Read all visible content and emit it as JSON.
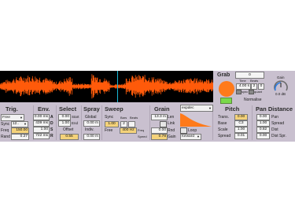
{
  "colors": {
    "accent": "#ff7a1a",
    "panel": "#c9c0cf",
    "waveform": "#ff5a0a",
    "playhead": "#19b8d6",
    "highlight": "#f4d27a",
    "normalise": "#7ad94a"
  },
  "sections": {
    "trig": "Trig.",
    "env": "Env.",
    "select": "Select",
    "spray": "Spray",
    "sweep": "Sweep",
    "grain": "Grain",
    "pitch": "Pitch",
    "pan_distance": "Pan Distance"
  },
  "trig": {
    "mode": "Free",
    "sync_label": "Sync",
    "sync_value": "12..",
    "freq_label": "Freq",
    "freq_value": "150.00",
    "rand_label": "Rand",
    "rand_value": "0.27"
  },
  "env": {
    "a_value": "0.00 ms",
    "a_label": "A",
    "d_value": "439 ms",
    "d_label": "D",
    "s_value": "1.00",
    "s_label": "S",
    "r_value": "722 ms",
    "r_label": "R"
  },
  "select": {
    "start_value": "0.00",
    "start_label": "Start",
    "end_value": "1.00",
    "end_label": "End",
    "offset_label": "Offset",
    "offset_value": "0.55"
  },
  "spray": {
    "global_label": "Global",
    "global_value": "0.00 m",
    "indiv_label": "Indiv.",
    "indiv_value": "0.00 m"
  },
  "sweep": {
    "sync_label": "Sync",
    "sync_value": "1.00",
    "bars_label": "Bars",
    "beats_label": "Beats",
    "beats_value": "2",
    "free_label": "Free",
    "free_value": "400 Hz",
    "freq_label": "Freq",
    "speed_label": "Speed"
  },
  "grain": {
    "len_value": "13.3 m",
    "len_label": "Len",
    "link_label": "Link",
    "rnd_value": "0.00",
    "rnd_label": "Rnd",
    "gain_value": "0.78",
    "gain_label": "Gain"
  },
  "window": {
    "shape": "expdec",
    "loop_label": "Loop",
    "direction": "forward"
  },
  "grab": {
    "title": "Grab",
    "field": "0",
    "time_label": "Time",
    "beats_label": "Beats",
    "time_value": "4.00 s",
    "beats_value": "2",
    "beats_b": "0",
    "sync_label": "sync",
    "quant_label": "quant",
    "normalise_label": "Normalise"
  },
  "gain_meter": {
    "label": "Gain",
    "value": "0.0 dB"
  },
  "pitch": {
    "trans_label": "Trans.",
    "trans_value": "0.00",
    "base_label": "Base",
    "base_value": "C3",
    "scale_label": "Scale",
    "scale_value": "1.00",
    "spread_label": "Spread",
    "spread_value": "0.01"
  },
  "pan": {
    "pan_label": "Pan",
    "pan_value": "0.00",
    "spread_label": "Spread",
    "spread_value": "1.00",
    "dist_label": "Dist",
    "dist_value": "0.82",
    "dist_spr_label": "Dist Spr.",
    "dist_spr_value": "0.00"
  }
}
